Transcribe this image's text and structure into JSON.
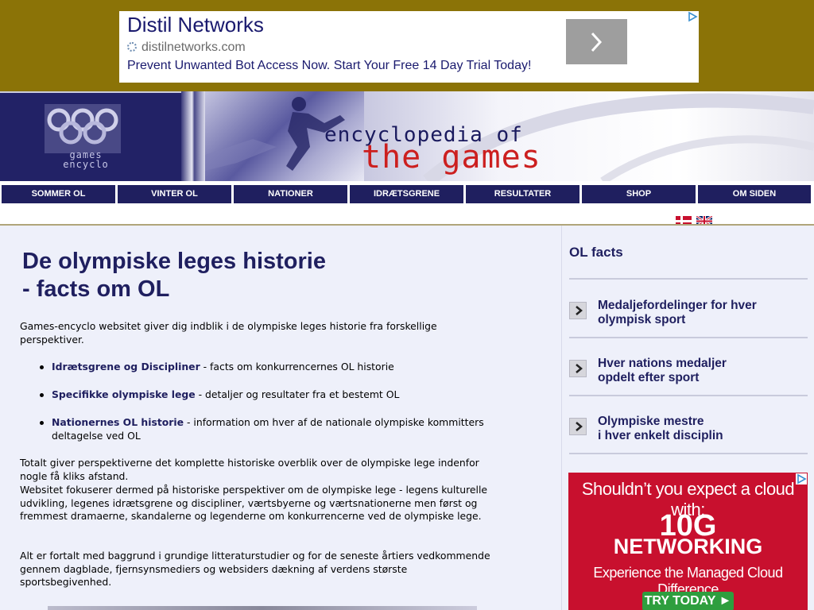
{
  "top_ad": {
    "title": "Distil Networks",
    "url": "distilnetworks.com",
    "description": "Prevent Unwanted Bot Access Now. Start Your Free 14 Day Trial Today!",
    "arrow_icon": "chevron-right-icon"
  },
  "banner": {
    "logo_text_1": "games",
    "logo_text_2": "encyclo",
    "tagline_1": "encyclopedia of",
    "tagline_2": "the games"
  },
  "nav": {
    "items": [
      {
        "label": "SOMMER OL"
      },
      {
        "label": "VINTER OL"
      },
      {
        "label": "NATIONER"
      },
      {
        "label": "IDRÆTSGRENE"
      },
      {
        "label": "RESULTATER"
      },
      {
        "label": "SHOP"
      },
      {
        "label": "OM SIDEN"
      }
    ]
  },
  "languages": [
    "Danish",
    "English"
  ],
  "main": {
    "title_line1": "De olympiske leges historie",
    "title_line2": "- facts om OL",
    "intro": "Games-encyclo websitet giver dig indblik i de olympiske leges historie fra forskellige perspektiver.",
    "bullets": [
      {
        "link": "Idrætsgrene og Discipliner",
        "text": " - facts om konkurrencernes OL historie"
      },
      {
        "link": "Specifikke olympiske lege",
        "text": " - detaljer og resultater fra et bestemt OL"
      },
      {
        "link": "Nationernes OL historie",
        "text": " - information om hver af de nationale olympiske kommitters deltagelse ved OL"
      }
    ],
    "para2": "Totalt giver perspektiverne det komplette historiske overblik over de olympiske lege indenfor nogle få kliks afstand.",
    "para3": "Websitet fokuserer dermed på historiske perspektiver om de olympiske lege - legens kulturelle udvikling, legenes idrætsgrene og discipliner, værtsbyerne og værtsnationerne men først og fremmest dramaerne, skandalerne og legenderne om konkurrencerne ved de olympiske lege.",
    "para4": "Alt er fortalt med baggrund i grundige litteraturstudier og for de seneste årtiers vedkommende gennem dagblade, fjernsynsmediers og websiders dækning af verdens største sportsbegivenhed."
  },
  "sidebar": {
    "title": "OL facts",
    "items": [
      {
        "line1": "Medaljefordelinger for hver",
        "line2": "olympisk sport"
      },
      {
        "line1": "Hver nations medaljer",
        "line2": "opdelt efter sport"
      },
      {
        "line1": "Olympiske mestre",
        "line2": "i hver enkelt disciplin"
      }
    ]
  },
  "side_ad": {
    "line1": "Shouldn’t you expect a cloud with:",
    "line2": "10G",
    "line3": "NETWORKING",
    "line4": "Experience the Managed Cloud Difference",
    "cta": "TRY TODAY ►"
  },
  "colors": {
    "navy": "#1f1f5f",
    "ad_band": "#8b7307",
    "content_bg": "#eef0fa",
    "accent_red": "#cc1f1f"
  }
}
